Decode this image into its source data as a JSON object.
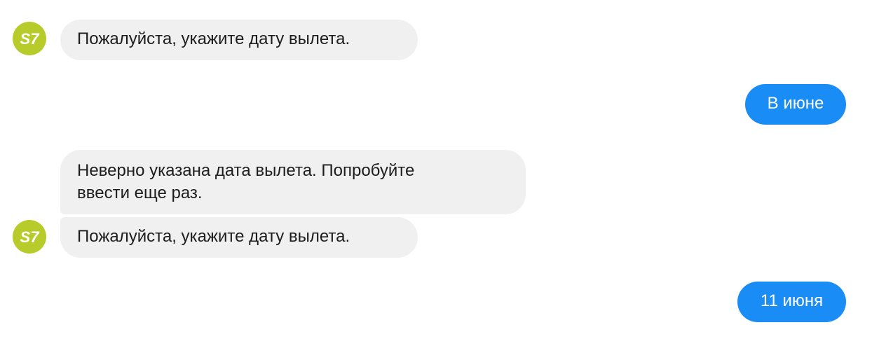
{
  "brand": {
    "logo_text": "S7",
    "logo_color": "#b7cb2b",
    "user_bubble_color": "#1a8cf5",
    "bot_bubble_color": "#f0f0f0"
  },
  "messages": [
    {
      "sender": "bot",
      "text": "Пожалуйста, укажите дату вылета."
    },
    {
      "sender": "user",
      "text": "В июне"
    },
    {
      "sender": "bot",
      "text_lines": [
        "Неверно указана дата вылета. Попробуйте",
        "ввести еще раз."
      ]
    },
    {
      "sender": "bot",
      "text": "Пожалуйста, укажите дату вылета."
    },
    {
      "sender": "user",
      "text": "11 июня"
    }
  ]
}
